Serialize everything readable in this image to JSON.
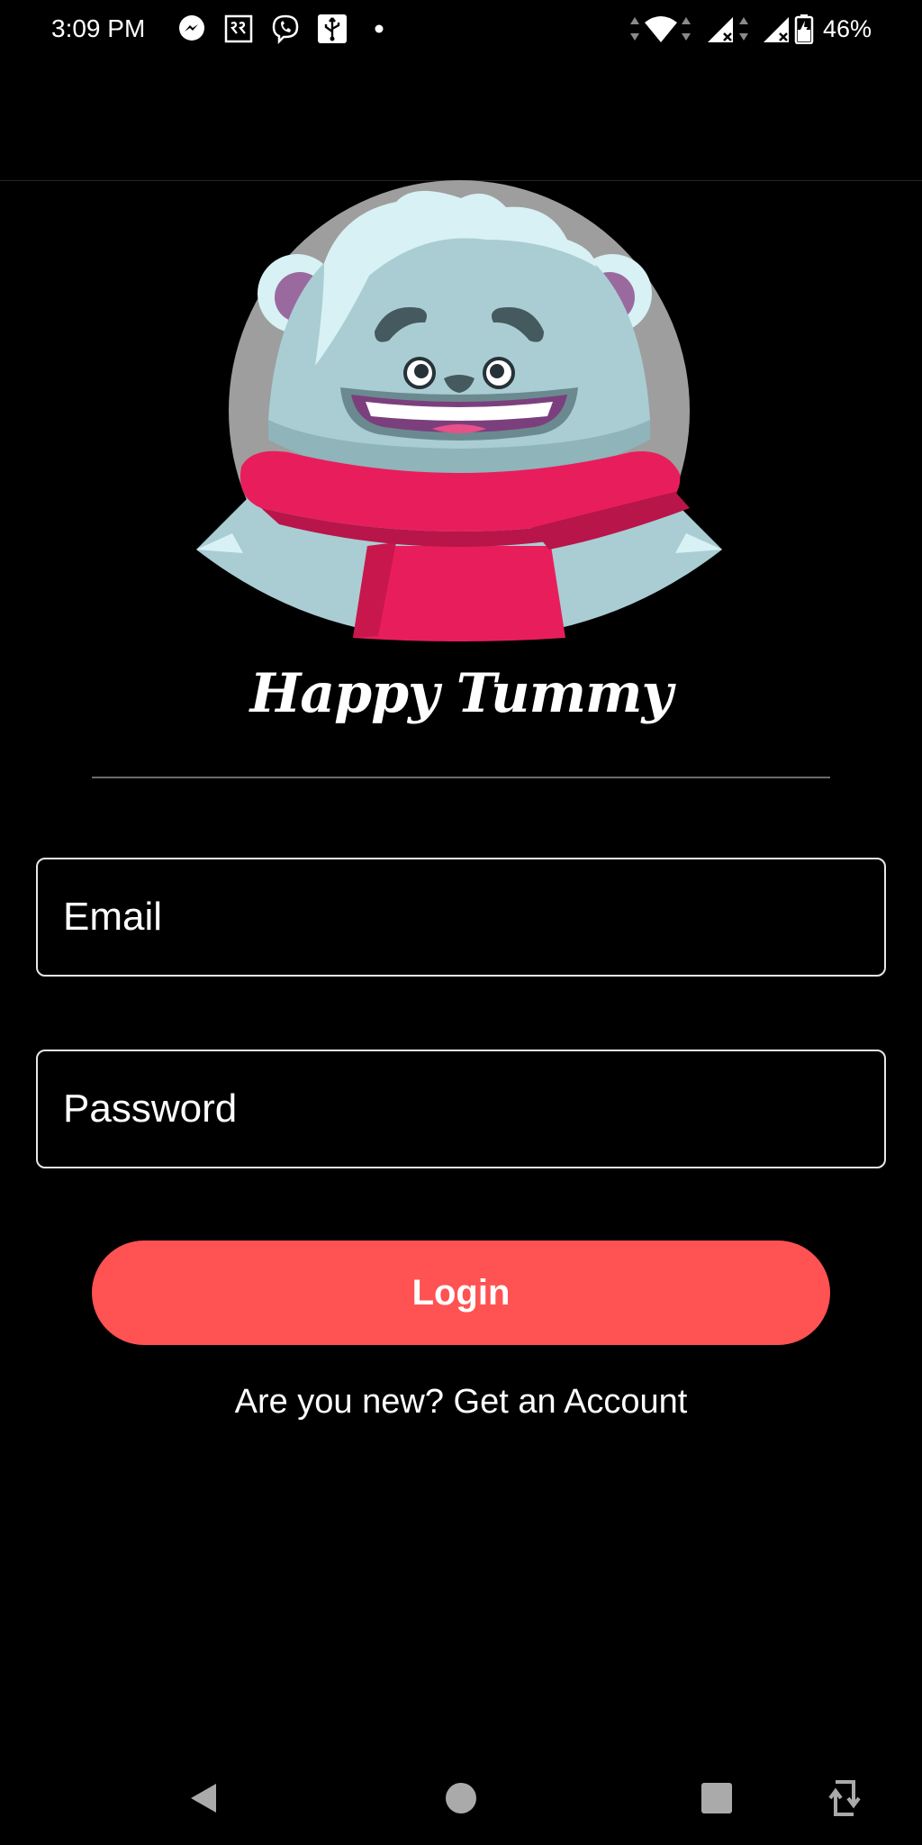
{
  "status_bar": {
    "time": "3:09 PM",
    "battery": "46%",
    "notification_icons": [
      "messenger-icon",
      "rr-app-icon",
      "viber-icon",
      "usb-icon",
      "dot-icon"
    ],
    "system_icons": [
      "data-arrows-icon",
      "wifi-icon",
      "signal-icon",
      "signal-icon",
      "battery-icon"
    ]
  },
  "app": {
    "title": "Happy Tummy"
  },
  "form": {
    "email_placeholder": "Email",
    "password_placeholder": "Password",
    "login_label": "Login",
    "signup_text": "Are you new? Get an Account"
  },
  "nav": {
    "items": [
      "back-icon",
      "home-icon",
      "recents-icon",
      "rotate-icon"
    ]
  },
  "colors": {
    "background": "#000000",
    "accent": "#ff5252",
    "mascot_circle": "#9e9e9e",
    "mascot_fur": "#a9cdd3",
    "mascot_scarf": "#e81e5c"
  }
}
